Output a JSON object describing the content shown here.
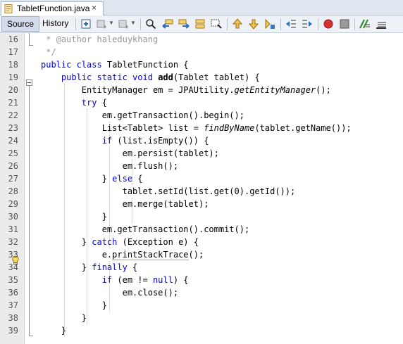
{
  "tab": {
    "title": "TabletFunction.java",
    "close": "×"
  },
  "toolbar": {
    "source_label": "Source",
    "history_label": "History",
    "icons": [
      "last-edit-icon",
      "back-icon",
      "forward-icon",
      "find-icon",
      "find-previous-icon",
      "find-next-icon",
      "toggle-highlight-icon",
      "find-selection-icon",
      "previous-bookmark-icon",
      "next-bookmark-icon",
      "toggle-bookmark-icon",
      "shift-left-icon",
      "shift-right-icon",
      "start-macro-icon",
      "stop-macro-icon",
      "comment-icon",
      "uncomment-icon"
    ],
    "colors": {
      "record": "#d93030",
      "accent": "#2a6ebd"
    }
  },
  "editor": {
    "lines": [
      {
        "n": "16",
        "html": "<span class=\"cm\"> * </span><span class=\"cm\">@author haleduykhang</span>"
      },
      {
        "n": "17",
        "html": "<span class=\"cm\"> */</span>"
      },
      {
        "n": "18",
        "html": "<span class=\"kw\">public class</span> TabletFunction {"
      },
      {
        "n": "19",
        "html": "    <span class=\"kw\">public static void</span> <b>add</b>(Tablet tablet) {"
      },
      {
        "n": "20",
        "html": "        EntityManager em = JPAUtility.<span class=\"it\">getEntityManager</span>();"
      },
      {
        "n": "21",
        "html": "        <span class=\"kw\">try</span> {"
      },
      {
        "n": "22",
        "html": "            em.getTransaction().begin();"
      },
      {
        "n": "23",
        "html": "            List&lt;Tablet&gt; list = <span class=\"it\">findByName</span>(tablet.getName());"
      },
      {
        "n": "24",
        "html": "            <span class=\"kw\">if</span> (list.isEmpty()) {"
      },
      {
        "n": "25",
        "html": "                em.persist(tablet);"
      },
      {
        "n": "26",
        "html": "                em.flush();"
      },
      {
        "n": "27",
        "html": "            } <span class=\"kw\">else</span> {"
      },
      {
        "n": "28",
        "html": "                tablet.setId(list.get(0).getId());"
      },
      {
        "n": "29",
        "html": "                em.merge(tablet);"
      },
      {
        "n": "30",
        "html": "            }"
      },
      {
        "n": "31",
        "html": "            em.getTransaction().commit();"
      },
      {
        "n": "32",
        "html": "        } <span class=\"kw\">catch</span> (Exception e) {"
      },
      {
        "n": "33",
        "html": "            e.<span class=\"squiggle\">printStackTrace</span>();"
      },
      {
        "n": "34",
        "html": "        } <span class=\"kw\">finally</span> {"
      },
      {
        "n": "35",
        "html": "            <span class=\"kw\">if</span> (em != <span class=\"kw\">null</span>) {"
      },
      {
        "n": "36",
        "html": "                em.close();"
      },
      {
        "n": "37",
        "html": "            }"
      },
      {
        "n": "38",
        "html": "        }"
      },
      {
        "n": "39",
        "html": "    }"
      }
    ],
    "hint_line": "33"
  }
}
